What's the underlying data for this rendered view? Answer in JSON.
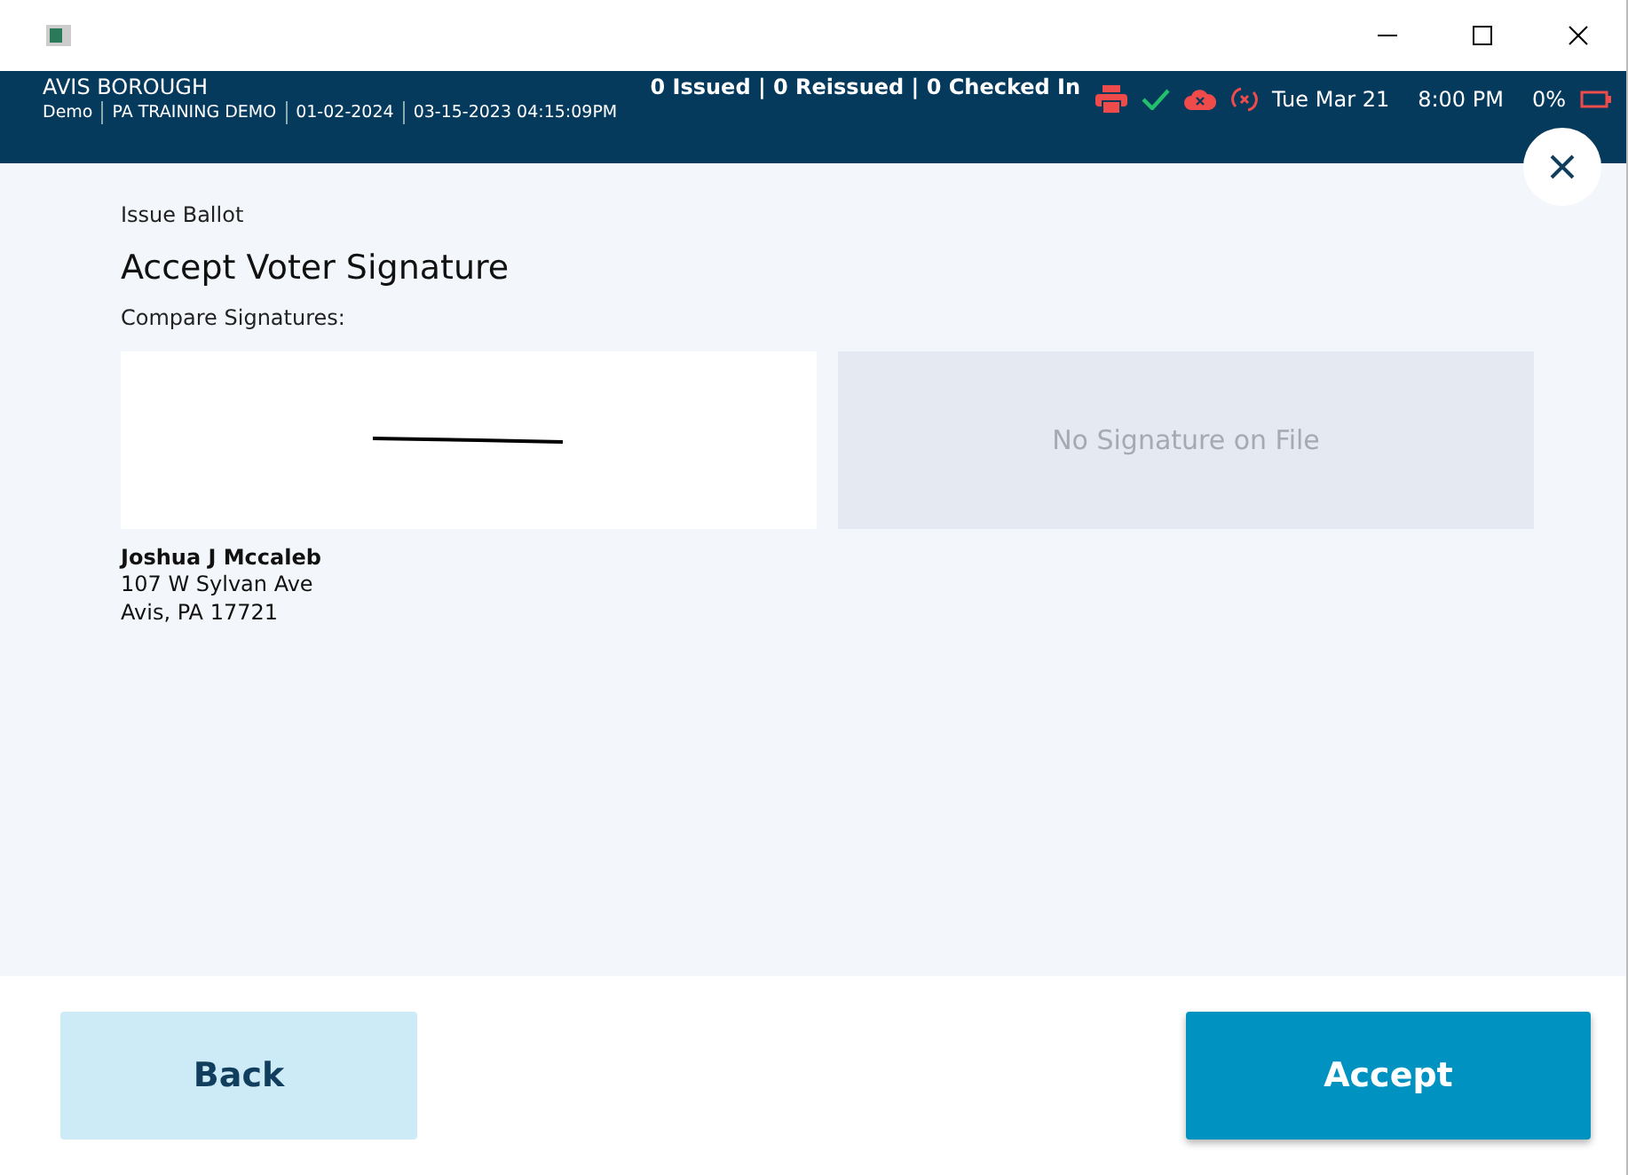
{
  "header": {
    "location": "AVIS BOROUGH",
    "meta": [
      "Demo",
      "PA TRAINING DEMO",
      "01-02-2024",
      "03-15-2023 04:15:09PM"
    ],
    "counts": "0 Issued | 0 Reissued | 0 Checked In",
    "date": "Tue Mar 21",
    "time": "8:00 PM",
    "battery": "0%"
  },
  "breadcrumb": "Issue Ballot",
  "title": "Accept Voter Signature",
  "compare_label": "Compare Signatures:",
  "signatures": [
    {
      "kind": "signature"
    },
    {
      "kind": "empty",
      "text": "No Signature on File"
    }
  ],
  "voter": {
    "name": "Joshua J Mccaleb",
    "address": [
      "107 W Sylvan Ave",
      "Avis, PA 17721"
    ]
  },
  "buttons": [
    {
      "label": "Back",
      "kind": "secondary"
    },
    {
      "label": "Accept",
      "kind": "primary"
    }
  ]
}
